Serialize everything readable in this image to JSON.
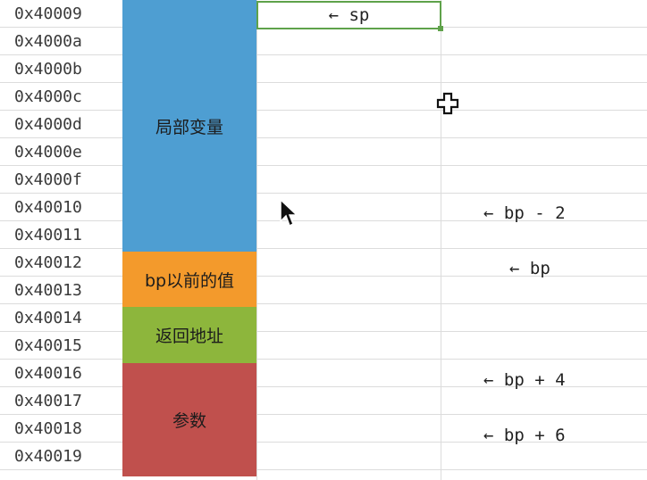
{
  "addresses": [
    "0x40009",
    "0x4000a",
    "0x4000b",
    "0x4000c",
    "0x4000d",
    "0x4000e",
    "0x4000f",
    "0x40010",
    "0x40011",
    "0x40012",
    "0x40013",
    "0x40014",
    "0x40015",
    "0x40016",
    "0x40017",
    "0x40018",
    "0x40019"
  ],
  "blocks": {
    "locals": {
      "label": "局部变量",
      "color": "#4e9ed2"
    },
    "saved_bp": {
      "label": "bp以前的值",
      "color": "#f39a2c"
    },
    "return_addr": {
      "label": "返回地址",
      "color": "#8db63c"
    },
    "params": {
      "label": "参数",
      "color": "#c0504d"
    }
  },
  "pointers": {
    "sp": "← sp",
    "bp_minus_2": "← bp - 2",
    "bp": "← bp",
    "bp_plus_4": "← bp + 4",
    "bp_plus_6": "← bp + 6"
  },
  "icons": {
    "plus_cursor": "crosshair-plus-icon",
    "arrow_cursor": "mouse-pointer-icon"
  }
}
